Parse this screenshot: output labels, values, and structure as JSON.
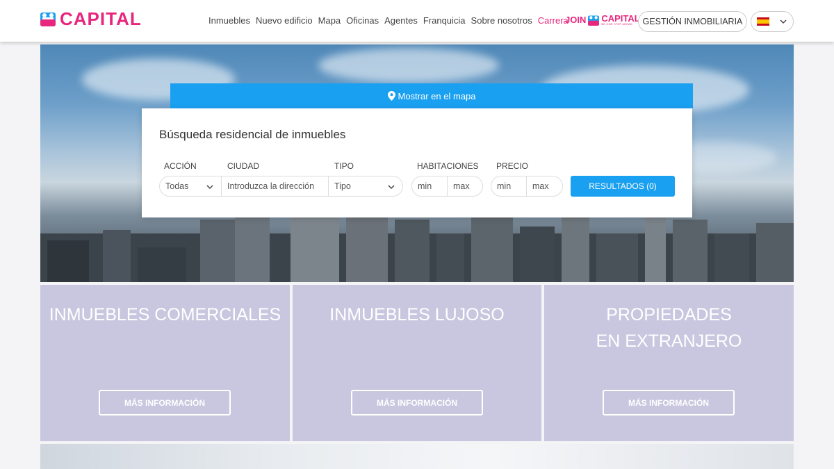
{
  "header": {
    "logo_text": "CAPITAL",
    "nav": [
      "Inmuebles",
      "Nuevo edificio",
      "Mapa",
      "Oficinas",
      "Agentes",
      "Franquicia",
      "Sobre nosotros",
      "Carrera"
    ],
    "join_word": "JOIN",
    "join_brand": "CAPITAL",
    "join_tagline": "BE ONE STEP AHEAD",
    "management_button": "GESTIÓN INMOBILIARIA",
    "language_flag": "flag-es-icon"
  },
  "search": {
    "map_link": "Mostrar en el mapa",
    "title": "Búsqueda residencial de inmuebles",
    "labels": {
      "action": "ACCIÓN",
      "city": "CIUDAD",
      "type": "TIPO",
      "rooms": "HABITACIONES",
      "price": "PRECIO"
    },
    "action_value": "Todas",
    "city_placeholder": "Introduzca la dirección",
    "type_value": "Tipo",
    "rooms_min": "min",
    "rooms_max": "max",
    "price_min": "min",
    "price_max": "max",
    "results_button": "RESULTADOS (0)"
  },
  "cards": [
    {
      "title_l1": "INMUEBLES COMERCIALES",
      "title_l2": "",
      "button": "MÁS INFORMACIÓN"
    },
    {
      "title_l1": "INMUEBLES LUJOSO",
      "title_l2": "",
      "button": "MÁS INFORMACIÓN"
    },
    {
      "title_l1": "PROPIEDADES",
      "title_l2": "EN EXTRANJERO",
      "button": "MÁS INFORMACIÓN"
    }
  ],
  "colors": {
    "brand_pink": "#e8267e",
    "accent_blue": "#1aa0f0",
    "card_bg": "#c9c6df"
  }
}
